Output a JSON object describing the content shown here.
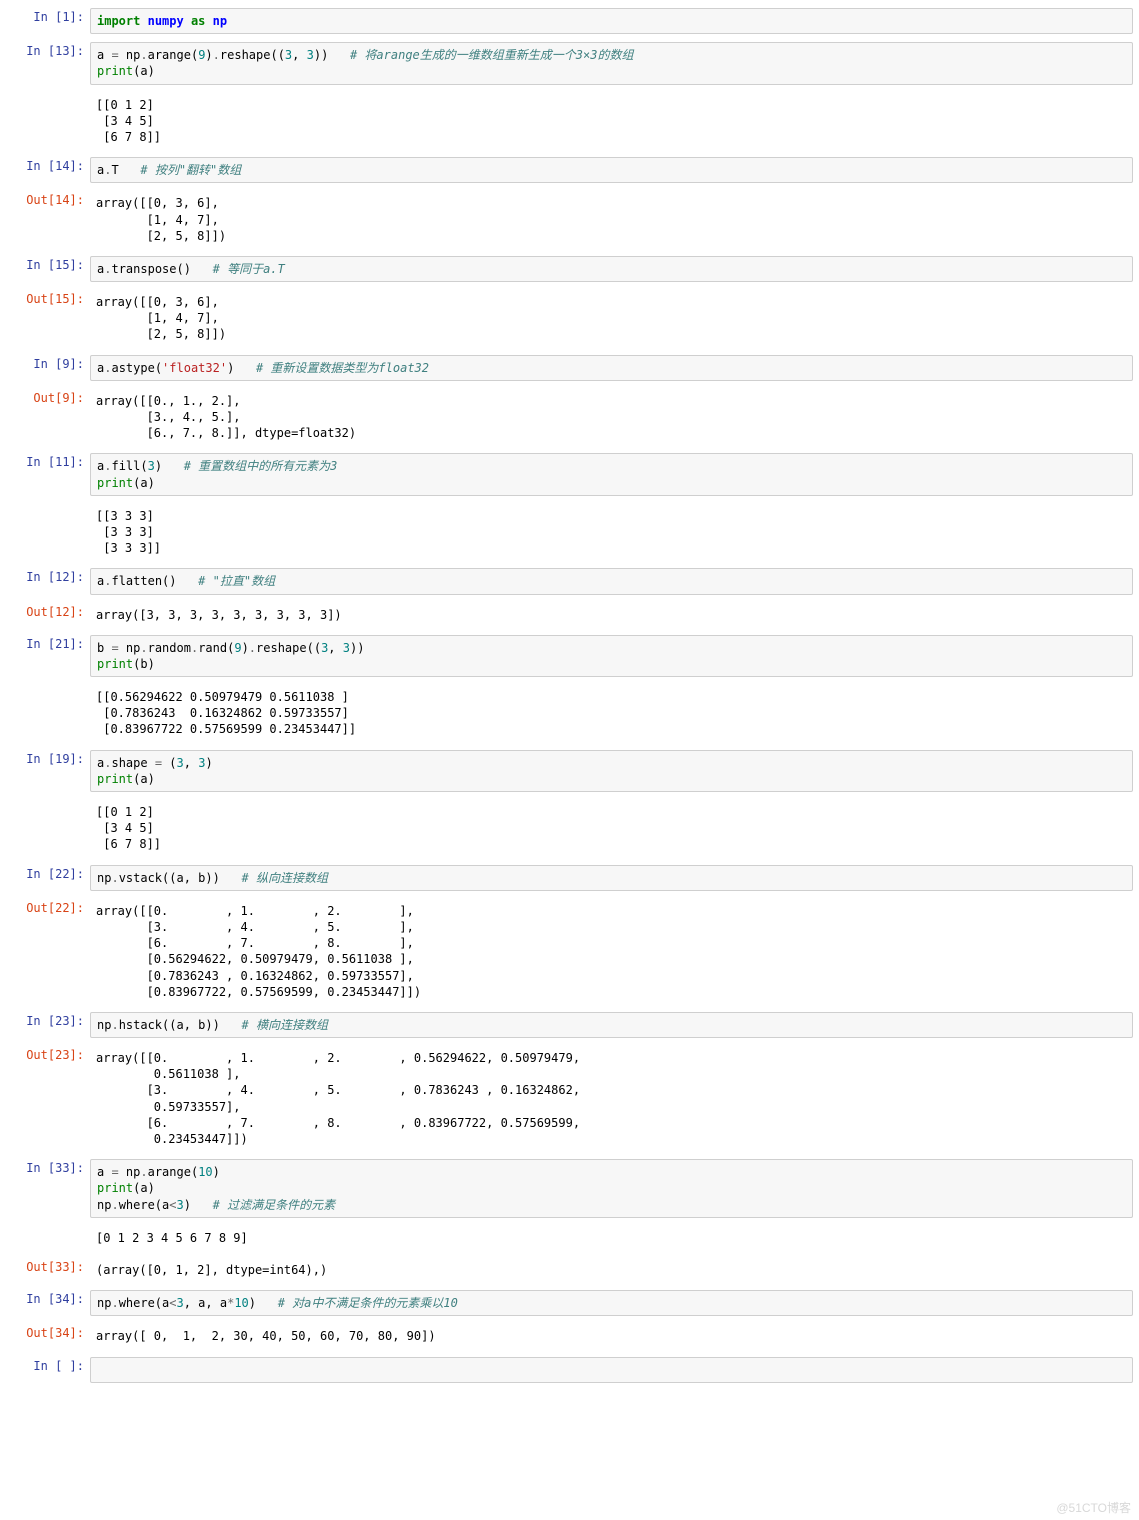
{
  "cells": [
    {
      "in_prompt": "In  [1]:",
      "code_html": "<span class='kw-green'>import</span> <span class='kw-blue'>numpy</span> <span class='kw-green'>as</span> <span class='kw-blue'>np</span>"
    },
    {
      "in_prompt": "In  [13]:",
      "code_html": "a <span class='op'>=</span> np<span class='op'>.</span>arange(<span class='num'>9</span>)<span class='op'>.</span>reshape((<span class='num'>3</span>, <span class='num'>3</span>))   <span class='cmt'># 将arange生成的一维数组重新生成一个3×3的数组</span>\n<span class='builtin'>print</span>(a)",
      "stream": "[[0 1 2]\n [3 4 5]\n [6 7 8]]"
    },
    {
      "in_prompt": "In  [14]:",
      "code_html": "a<span class='op'>.</span>T   <span class='cmt'># 按列\"翻转\"数组</span>",
      "out_prompt": "Out[14]:",
      "output": "array([[0, 3, 6],\n       [1, 4, 7],\n       [2, 5, 8]])"
    },
    {
      "in_prompt": "In  [15]:",
      "code_html": "a<span class='op'>.</span>transpose()   <span class='cmt'># 等同于a.T</span>",
      "out_prompt": "Out[15]:",
      "output": "array([[0, 3, 6],\n       [1, 4, 7],\n       [2, 5, 8]])"
    },
    {
      "in_prompt": "In  [9]:",
      "code_html": "a<span class='op'>.</span>astype(<span class='str'>'float32'</span>)   <span class='cmt'># 重新设置数据类型为float32</span>",
      "out_prompt": "Out[9]:",
      "output": "array([[0., 1., 2.],\n       [3., 4., 5.],\n       [6., 7., 8.]], dtype=float32)"
    },
    {
      "in_prompt": "In  [11]:",
      "code_html": "a<span class='op'>.</span>fill(<span class='num'>3</span>)   <span class='cmt'># 重置数组中的所有元素为3</span>\n<span class='builtin'>print</span>(a)",
      "stream": "[[3 3 3]\n [3 3 3]\n [3 3 3]]"
    },
    {
      "in_prompt": "In  [12]:",
      "code_html": "a<span class='op'>.</span>flatten()   <span class='cmt'># \"拉直\"数组</span>",
      "out_prompt": "Out[12]:",
      "output": "array([3, 3, 3, 3, 3, 3, 3, 3, 3])"
    },
    {
      "in_prompt": "In  [21]:",
      "code_html": "b <span class='op'>=</span> np<span class='op'>.</span>random<span class='op'>.</span>rand(<span class='num'>9</span>)<span class='op'>.</span>reshape((<span class='num'>3</span>, <span class='num'>3</span>))\n<span class='builtin'>print</span>(b)",
      "stream": "[[0.56294622 0.50979479 0.5611038 ]\n [0.7836243  0.16324862 0.59733557]\n [0.83967722 0.57569599 0.23453447]]"
    },
    {
      "in_prompt": "In  [19]:",
      "code_html": "a<span class='op'>.</span>shape <span class='op'>=</span> (<span class='num'>3</span>, <span class='num'>3</span>)\n<span class='builtin'>print</span>(a)",
      "stream": "[[0 1 2]\n [3 4 5]\n [6 7 8]]"
    },
    {
      "in_prompt": "In  [22]:",
      "code_html": "np<span class='op'>.</span>vstack((a, b))   <span class='cmt'># 纵向连接数组</span>",
      "out_prompt": "Out[22]:",
      "output": "array([[0.        , 1.        , 2.        ],\n       [3.        , 4.        , 5.        ],\n       [6.        , 7.        , 8.        ],\n       [0.56294622, 0.50979479, 0.5611038 ],\n       [0.7836243 , 0.16324862, 0.59733557],\n       [0.83967722, 0.57569599, 0.23453447]])"
    },
    {
      "in_prompt": "In  [23]:",
      "code_html": "np<span class='op'>.</span>hstack((a, b))   <span class='cmt'># 横向连接数组</span>",
      "out_prompt": "Out[23]:",
      "output": "array([[0.        , 1.        , 2.        , 0.56294622, 0.50979479,\n        0.5611038 ],\n       [3.        , 4.        , 5.        , 0.7836243 , 0.16324862,\n        0.59733557],\n       [6.        , 7.        , 8.        , 0.83967722, 0.57569599,\n        0.23453447]])"
    },
    {
      "in_prompt": "In  [33]:",
      "code_html": "a <span class='op'>=</span> np<span class='op'>.</span>arange(<span class='num'>10</span>)\n<span class='builtin'>print</span>(a)\nnp<span class='op'>.</span>where(a<span class='op'>&lt;</span><span class='num'>3</span>)   <span class='cmt'># 过滤满足条件的元素</span>",
      "stream": "[0 1 2 3 4 5 6 7 8 9]",
      "out_prompt": "Out[33]:",
      "output": "(array([0, 1, 2], dtype=int64),)"
    },
    {
      "in_prompt": "In  [34]:",
      "code_html": "np<span class='op'>.</span>where(a<span class='op'>&lt;</span><span class='num'>3</span>, a, a<span class='op'>*</span><span class='num'>10</span>)   <span class='cmt'># 对a中不满足条件的元素乘以10</span>",
      "out_prompt": "Out[34]:",
      "output": "array([ 0,  1,  2, 30, 40, 50, 60, 70, 80, 90])"
    },
    {
      "in_prompt": "In  [ ]:",
      "code_html": " "
    }
  ],
  "watermark": "@51CTO博客"
}
